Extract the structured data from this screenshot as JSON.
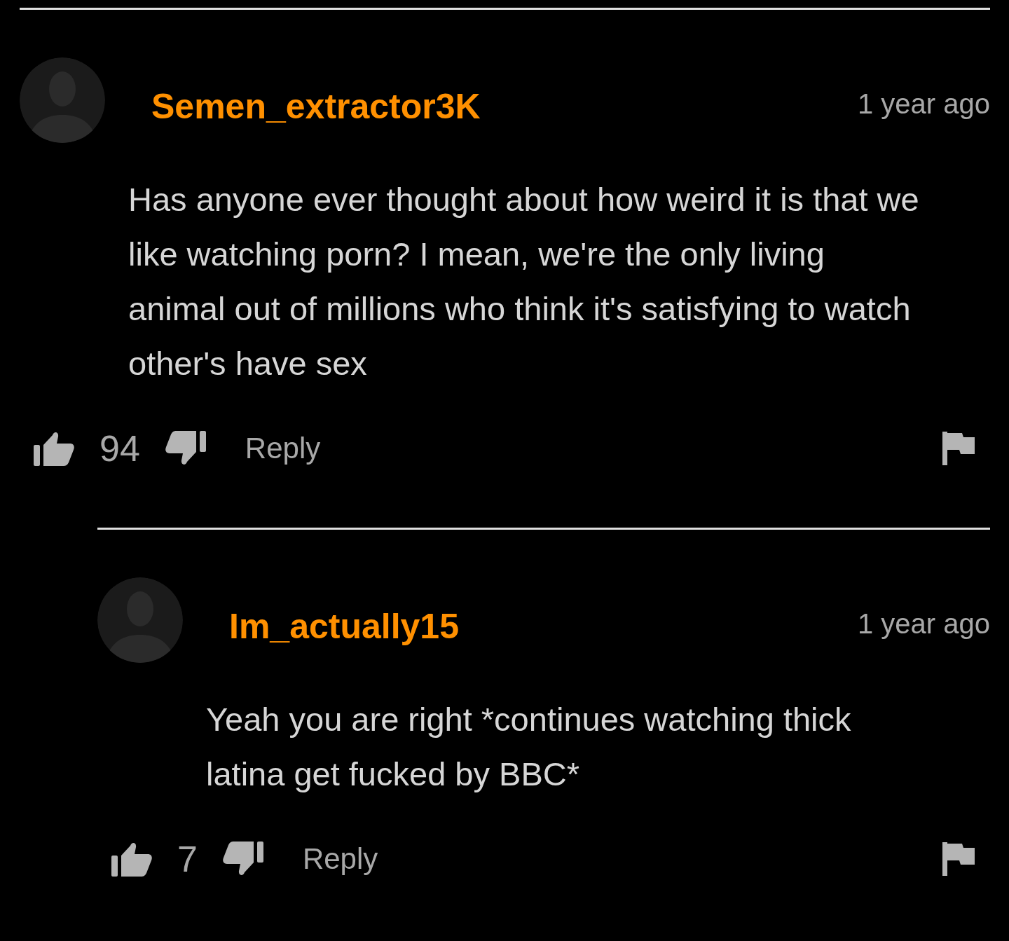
{
  "comments": [
    {
      "author": "Semen_extractor3K",
      "time": "1 year ago",
      "body": "Has anyone ever thought about how weird it is that we like watching porn? I mean, we're the only living animal out of millions who think it's satisfying to watch other's have sex",
      "votes": "94",
      "reply_label": "Reply",
      "children": [
        {
          "author": "Im_actually15",
          "time": "1 year ago",
          "body": "Yeah you are right *continues watching thick latina get fucked by BBC*",
          "votes": "7",
          "reply_label": "Reply"
        }
      ]
    }
  ]
}
